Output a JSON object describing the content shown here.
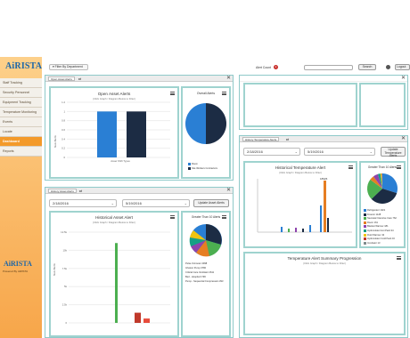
{
  "app": {
    "logo": "AiRISTA",
    "powered_by": "Powered By AiRISTA"
  },
  "sidebar": {
    "items": [
      {
        "label": "Staff Tracking",
        "active": false
      },
      {
        "label": "Security Personnel",
        "active": false
      },
      {
        "label": "Equipment Tracking",
        "active": false
      },
      {
        "label": "Temperature Monitoring",
        "active": false
      },
      {
        "label": "Events",
        "active": false
      },
      {
        "label": "Locate",
        "active": false
      },
      {
        "label": "Dashboard",
        "active": true
      },
      {
        "label": "Reports",
        "active": false
      }
    ]
  },
  "topbar": {
    "filter_label": "Filter By Department",
    "alert_count_label": "Alert Count",
    "alert_count_value": "2",
    "search_placeholder": "",
    "search_label": "Search",
    "logout_label": "Logout"
  },
  "panels": {
    "open_asset": {
      "tab": "Open Asset Alerts",
      "box_title": "Open Asset Alerts",
      "box_sub": "(Click Graph / Diagram Below to Filter)",
      "overall_title": "Overall Alerts",
      "legend": [
        {
          "label": "Room",
          "color": "#2a7fd4"
        },
        {
          "label": "Site Workers Contractors",
          "color": "#1c2c44"
        }
      ]
    },
    "history_asset": {
      "tab": "History Asset Alerts",
      "from_date": "2/18/2016",
      "to_date": "5/19/2016",
      "update_label": "Update Asset Alerts",
      "box_title": "Historical Asset Alert",
      "box_sub": "(Click Graph / Diagram Below to Filter)",
      "greater_title": "Greater Than 10 Alerts",
      "legend": [
        {
          "label": "Pulse Oximeter",
          "value": "4098",
          "color": "#2a7fd4"
        },
        {
          "label": "Infusion Pump",
          "value": "3780",
          "color": "#1c2c44"
        },
        {
          "label": "Critical Care Ventilator",
          "value": "2611",
          "color": "#4caf50"
        },
        {
          "label": "Bed - Hospital",
          "value": "1796",
          "color": "#e67e22"
        },
        {
          "label": "Pump - Sequential Compression",
          "value": "393",
          "color": "#8e44ad"
        }
      ]
    },
    "history_temp": {
      "tab": "History Temperature Alerts",
      "from_date": "2/18/2016",
      "to_date": "5/19/2016",
      "update_label": "Update Temperature Alerts",
      "box_title": "Historical Temperature Alert",
      "box_sub": "(Click Graph / Diagram Below to Filter)",
      "greater_title": "Greater Than 10 Alerts",
      "peak_label": "18926",
      "legend": [
        {
          "label": "Refrigerator",
          "value": "1021",
          "color": "#2a7fd4"
        },
        {
          "label": "Freezer",
          "value": "1128",
          "color": "#1c2c44"
        },
        {
          "label": "Neonatal Intensive Care",
          "value": "762",
          "color": "#4caf50"
        },
        {
          "label": "Room",
          "value": "161",
          "color": "#e67e22"
        },
        {
          "label": "Blanket Warmer",
          "value": "181",
          "color": "#8e44ad"
        },
        {
          "label": "Hydroculator Hot Pack",
          "value": "94",
          "color": "#16a085"
        },
        {
          "label": "Fluid Warmer",
          "value": "43",
          "color": "#f1c40f"
        },
        {
          "label": "Hydroculator Cold Pack",
          "value": "16",
          "color": "#c0392b"
        },
        {
          "label": "Incubator",
          "value": "13",
          "color": "#7f8c8d"
        }
      ]
    },
    "temp_summary": {
      "box_title": "Temperature Alert Summary Progression",
      "box_sub": "(Click Graph / Diagram Below to Filter)"
    }
  },
  "chart_data": [
    {
      "type": "bar",
      "title": "Open Asset Alerts",
      "categories": [
        "Asset Shift Types"
      ],
      "series": [
        {
          "name": "Room",
          "values": [
            1
          ]
        },
        {
          "name": "Site Workers Contractors",
          "values": [
            1
          ]
        }
      ],
      "ylabel": "Num Alerts",
      "yticks": [
        "1.2",
        "1",
        "0.8",
        "0.6",
        "0.4",
        "0.2",
        "0"
      ],
      "ylim": [
        0,
        1.2
      ]
    },
    {
      "type": "pie",
      "title": "Overall Alerts",
      "labels": [
        "Room",
        "Site Workers Contractors"
      ],
      "values": [
        1,
        1
      ]
    },
    {
      "type": "bar",
      "title": "Historical Asset Alert",
      "ylabel": "Num Alerts",
      "yticks": [
        "12.5k",
        "10k",
        "7.5k",
        "5k",
        "2.5k",
        "0"
      ],
      "ylim": [
        0,
        12500
      ],
      "values_visible": [
        11000,
        1400,
        600
      ]
    },
    {
      "type": "pie",
      "title": "Greater Than 10 Alerts",
      "labels": [
        "Refrigerator",
        "Freezer",
        "Neonatal Intensive Care",
        "Room",
        "Blanket Warmer",
        "Hydroculator Hot Pack",
        "Fluid Warmer",
        "Hydroculator Cold Pack",
        "Incubator"
      ],
      "values": [
        1021,
        1128,
        762,
        161,
        181,
        94,
        43,
        16,
        13
      ]
    }
  ]
}
